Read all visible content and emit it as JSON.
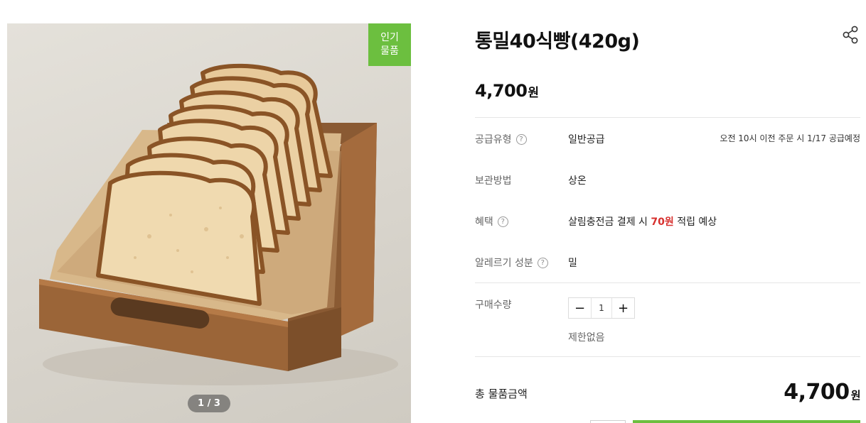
{
  "gallery": {
    "badge_line1": "인기",
    "badge_line2": "물품",
    "counter": "1 / 3"
  },
  "product": {
    "title": "통밀40식빵(420g)",
    "price": "4,700",
    "price_unit": "원"
  },
  "info": {
    "supply_type": {
      "label": "공급유형",
      "value": "일반공급",
      "note": "오전 10시 이전 주문 시 1/17 공급예정"
    },
    "storage": {
      "label": "보관방법",
      "value": "상온"
    },
    "benefit": {
      "label": "혜택",
      "value_prefix": "살림충전금 결제 시 ",
      "value_highlight": "70원",
      "value_suffix": " 적립 예상"
    },
    "allergy": {
      "label": "알레르기 성분",
      "value": "밀"
    },
    "quantity": {
      "label": "구매수량",
      "value": "1",
      "minus": "−",
      "plus": "+",
      "limit": "제한없음"
    }
  },
  "total": {
    "label": "총 물품금액",
    "price": "4,700",
    "unit": "원"
  },
  "colors": {
    "accent_green": "#6cbf3f",
    "highlight_red": "#d7302e"
  },
  "icons": {
    "share": "share-icon",
    "help": "question-circle-icon"
  }
}
